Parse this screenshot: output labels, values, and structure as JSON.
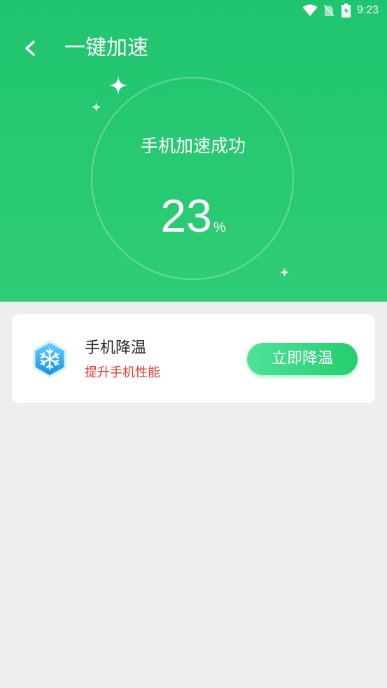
{
  "status_bar": {
    "time": "9:23",
    "icons": [
      "wifi-icon",
      "no-sim-icon",
      "battery-charging-icon"
    ]
  },
  "header": {
    "title": "一键加速",
    "back_icon": "chevron-left-icon"
  },
  "result": {
    "message": "手机加速成功",
    "percent": "23",
    "percent_unit": "%"
  },
  "card": {
    "icon": "snowflake-icon",
    "title": "手机降温",
    "subtitle": "提升手机性能",
    "button_label": "立即降温"
  },
  "colors": {
    "hero_green": "#20c56f",
    "subtitle_red": "#e03a2e",
    "button_green": "#23cf6d",
    "page_bg": "#eeeeee"
  }
}
